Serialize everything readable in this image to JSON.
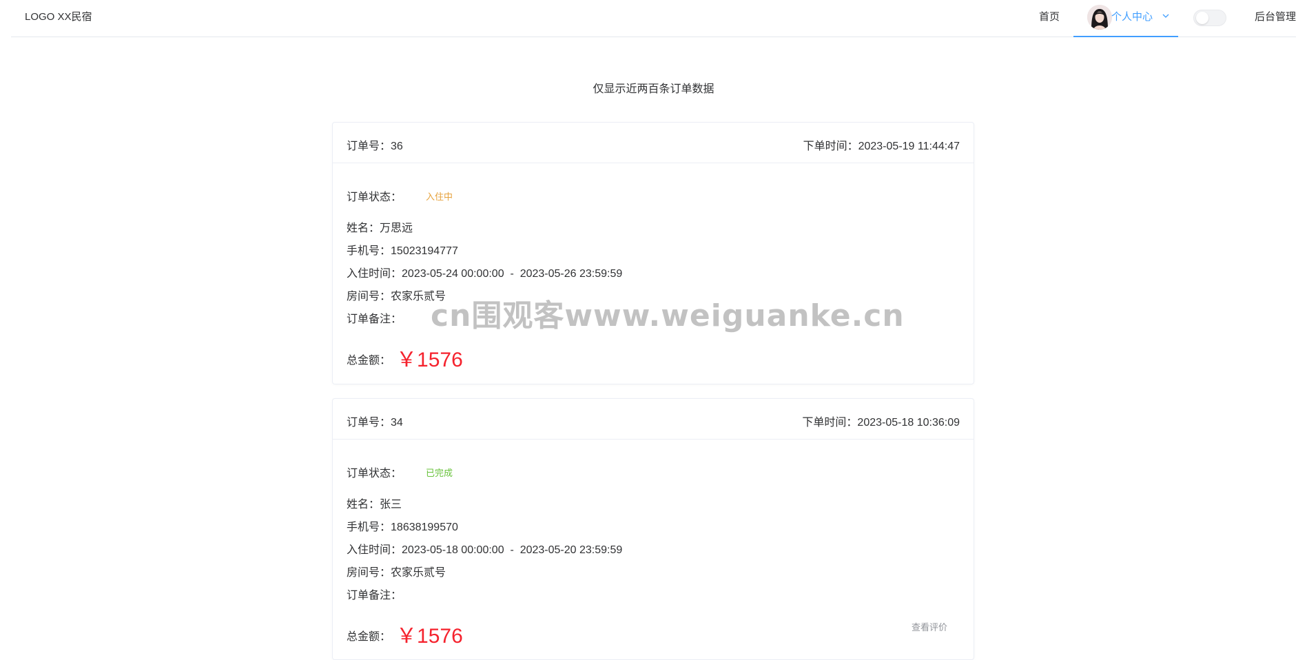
{
  "navbar": {
    "logo": "LOGO XX民宿",
    "home": "首页",
    "user_center": "个人中心",
    "admin": "后台管理"
  },
  "notice": "仅显示近两百条订单数据",
  "labels": {
    "order_no": "订单号：",
    "order_time": "下单时间：",
    "status": "订单状态：",
    "name": "姓名：",
    "phone": "手机号：",
    "checkin": "入住时间：",
    "room": "房间号：",
    "remark": "订单备注：",
    "total": "总金额："
  },
  "orders": [
    {
      "order_no": "36",
      "order_time": "2023-05-19 11:44:47",
      "status": "入住中",
      "status_color": "#e6a23c",
      "name": "万思远",
      "phone": "15023194777",
      "checkin_start": "2023-05-24 00:00:00",
      "checkin_sep": "-",
      "checkin_end": "2023-05-26 23:59:59",
      "room": "农家乐贰号",
      "remark": "",
      "total": "￥1576"
    },
    {
      "order_no": "34",
      "order_time": "2023-05-18 10:36:09",
      "status": "已完成",
      "status_color": "#67c23a",
      "name": "张三",
      "phone": "18638199570",
      "checkin_start": "2023-05-18 00:00:00",
      "checkin_sep": "-",
      "checkin_end": "2023-05-20 23:59:59",
      "room": "农家乐贰号",
      "remark": "",
      "total": "￥1576",
      "action": "查看评价"
    }
  ],
  "watermark": "cn围观客www.weiguanke.cn",
  "colors": {
    "accent": "#409eff",
    "price": "#f5222d"
  }
}
